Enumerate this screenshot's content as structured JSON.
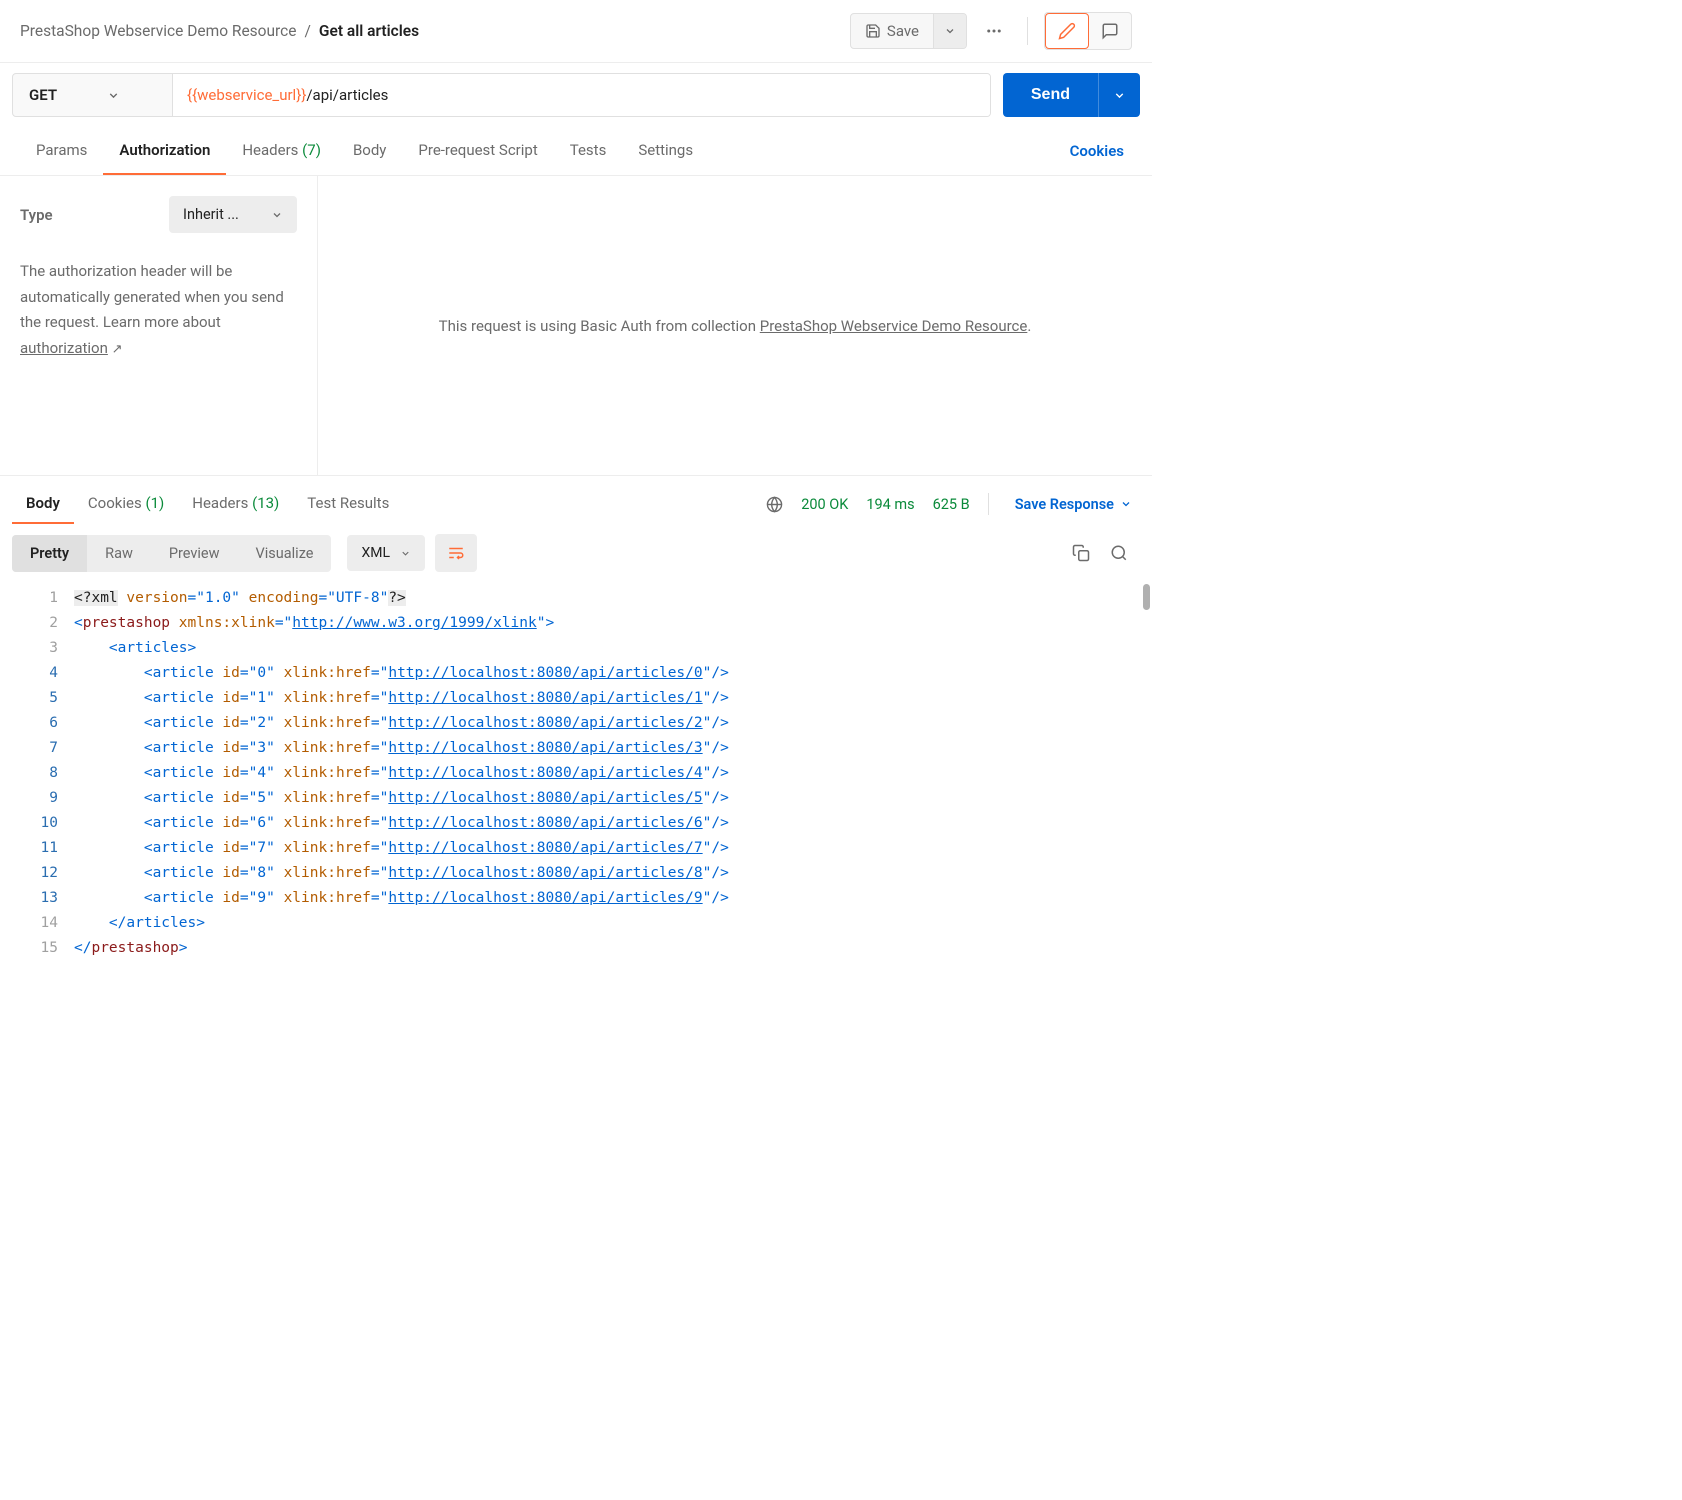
{
  "breadcrumb": {
    "collection": "PrestaShop Webservice Demo Resource",
    "sep": "/",
    "request": "Get all articles"
  },
  "header": {
    "save_label": "Save"
  },
  "request": {
    "method": "GET",
    "url_var": "{{webservice_url}}",
    "url_path": "/api/articles",
    "send_label": "Send"
  },
  "req_tabs": {
    "params": "Params",
    "authorization": "Authorization",
    "headers": "Headers",
    "headers_count": "(7)",
    "body": "Body",
    "prerequest": "Pre-request Script",
    "tests": "Tests",
    "settings": "Settings",
    "cookies": "Cookies"
  },
  "auth": {
    "type_label": "Type",
    "type_value": "Inherit ...",
    "desc1": "The authorization header will be automatically generated when you send the request. Learn more about ",
    "desc_link": "authorization",
    "desc_ext": "↗",
    "right_prefix": "This request is using Basic Auth from collection ",
    "right_link": "PrestaShop Webservice Demo Resource",
    "right_suffix": "."
  },
  "resp_tabs": {
    "body": "Body",
    "cookies": "Cookies",
    "cookies_count": "(1)",
    "headers": "Headers",
    "headers_count": "(13)",
    "test_results": "Test Results"
  },
  "resp_meta": {
    "status": "200 OK",
    "time": "194 ms",
    "size": "625 B",
    "save_response": "Save Response"
  },
  "resp_toolbar": {
    "pretty": "Pretty",
    "raw": "Raw",
    "preview": "Preview",
    "visualize": "Visualize",
    "format": "XML"
  },
  "code": {
    "total_lines": 15,
    "indent_lines_start": 4,
    "indent_lines_end": 13,
    "xml_decl_open": "<?xml",
    "xml_decl_version_attr": "version",
    "xml_decl_version_val": "\"1.0\"",
    "xml_decl_encoding_attr": "encoding",
    "xml_decl_encoding_val": "\"UTF-8\"",
    "xml_decl_close": "?>",
    "root_open_tag": "prestashop",
    "root_ns_attr": "xmlns:xlink",
    "root_ns_val": "http://www.w3.org/1999/xlink",
    "articles_tag": "articles",
    "article_tag": "article",
    "id_attr": "id",
    "href_attr": "xlink:href",
    "articles": [
      {
        "id": "0",
        "href": "http://localhost:8080/api/articles/0"
      },
      {
        "id": "1",
        "href": "http://localhost:8080/api/articles/1"
      },
      {
        "id": "2",
        "href": "http://localhost:8080/api/articles/2"
      },
      {
        "id": "3",
        "href": "http://localhost:8080/api/articles/3"
      },
      {
        "id": "4",
        "href": "http://localhost:8080/api/articles/4"
      },
      {
        "id": "5",
        "href": "http://localhost:8080/api/articles/5"
      },
      {
        "id": "6",
        "href": "http://localhost:8080/api/articles/6"
      },
      {
        "id": "7",
        "href": "http://localhost:8080/api/articles/7"
      },
      {
        "id": "8",
        "href": "http://localhost:8080/api/articles/8"
      },
      {
        "id": "9",
        "href": "http://localhost:8080/api/articles/9"
      }
    ]
  }
}
